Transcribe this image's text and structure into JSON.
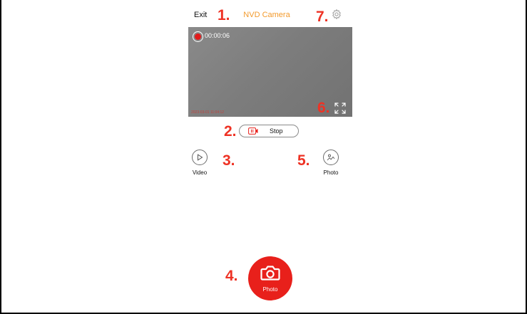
{
  "header": {
    "exit_label": "Exit",
    "title": "NVD Camera",
    "settings_icon": "gear-icon"
  },
  "annotations": {
    "n1": "1.",
    "n2": "2.",
    "n3": "3.",
    "n4": "4.",
    "n5": "5.",
    "n6": "6.",
    "n7": "7."
  },
  "preview": {
    "recording_time": "00:00:06",
    "timestamp": "2023-03-01 11:04:12",
    "fullscreen_icon": "fullscreen-icon"
  },
  "controls": {
    "stop_label": "Stop",
    "video_label": "Video",
    "gallery_label": "Photo",
    "shutter_label": "Photo"
  },
  "colors": {
    "title": "#f39a2c",
    "annotation": "#ee3224",
    "shutter": "#e8201b",
    "record": "#e21b1b"
  }
}
